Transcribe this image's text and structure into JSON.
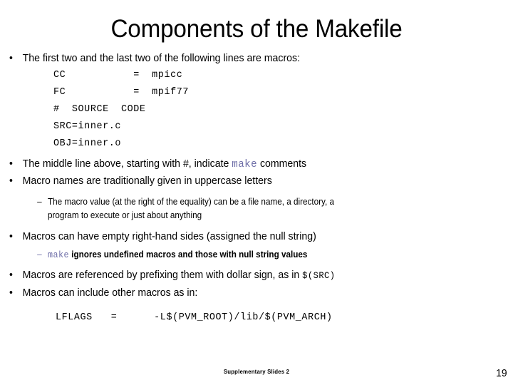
{
  "slide": {
    "title": "Components of the Makefile",
    "page_number": "19",
    "footer": "Supplementary Slides 2",
    "colors": {
      "text": "#000000",
      "keyword_make": "#6f6fa8",
      "background": "#ffffff"
    },
    "bullet_marker": "•",
    "sub_bullet_marker": "–",
    "bullets": {
      "intro": "The first two and the last two of the following lines are macros:",
      "middle_line_prefix": "The middle line above, starting with #, indicate ",
      "middle_line_keyword": "make",
      "middle_line_suffix": " comments",
      "macro_names": "Macro names are traditionally given in uppercase letters",
      "macro_value_line1": "The macro value (at the right of the equality) can be a file name, a directory, a",
      "macro_value_line2": "program to execute or just about anything",
      "empty_rhs": "Macros can have empty right-hand sides (assigned the null string)",
      "ignores_keyword": "make",
      "ignores_suffix": " ignores undefined macros and those with null string values",
      "referenced_prefix": "Macros are referenced by prefixing them with dollar sign, as in ",
      "referenced_code": "$(SRC)",
      "include_other": "Macros can include other macros as in:"
    },
    "code_block": {
      "lines": [
        "CC           =  mpicc",
        "FC           =  mpif77",
        "#  SOURCE  CODE",
        "SRC=inner.c",
        "OBJ=inner.o"
      ]
    },
    "lflags_line": "LFLAGS   =      -L$(PVM_ROOT)/lib/$(PVM_ARCH)"
  }
}
